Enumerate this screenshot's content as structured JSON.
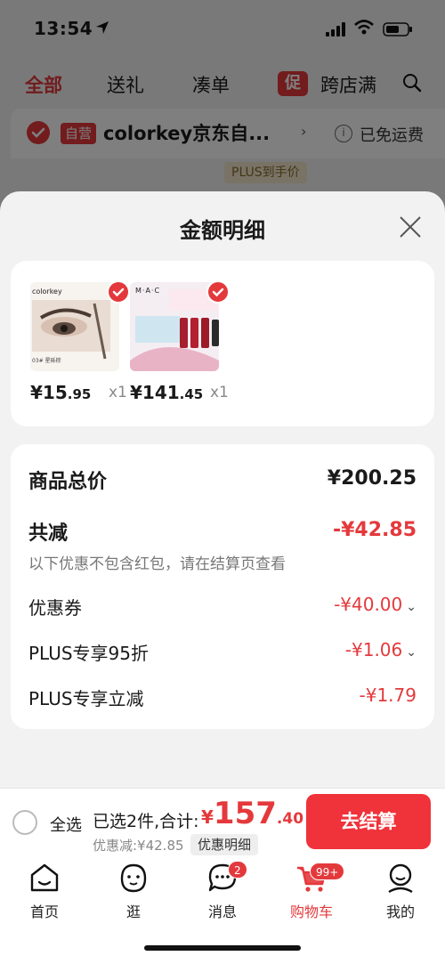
{
  "status_bar": {
    "time": "13:54"
  },
  "category_tabs": {
    "items": [
      "全部",
      "送礼",
      "凑单",
      "跨店满"
    ],
    "promo_badge": "促"
  },
  "store": {
    "tag": "自营",
    "name": "colorkey京东自...",
    "shipping": "已免运费",
    "plus_tag": "PLUS到手价"
  },
  "sheet": {
    "title": "金额明细",
    "products": [
      {
        "brand": "colorkey",
        "price_int": "¥15",
        "price_dec": ".95",
        "qty": "x1"
      },
      {
        "brand": "MAC",
        "price_int": "¥141",
        "price_dec": ".45",
        "qty": "x1"
      }
    ],
    "summary": {
      "total_label": "商品总价",
      "total_value": "¥200.25",
      "reduce_label": "共减",
      "reduce_value": "-¥42.85",
      "reduce_note": "以下优惠不包含红包，请在结算页查看",
      "coupon_label": "优惠券",
      "coupon_value": "-¥40.00",
      "plus95_label": "PLUS专享95折",
      "plus95_value": "-¥1.06",
      "plus_reduce_label": "PLUS专享立减",
      "plus_reduce_value": "-¥1.79"
    }
  },
  "bottom_bar": {
    "select_all": "全选",
    "selected_text": "已选2件,合计:",
    "total_currency": "¥",
    "total_int": "157",
    "total_dec": ".40",
    "discount_text": "优惠减:¥42.85",
    "detail_button": "优惠明细",
    "checkout_button": "去结算"
  },
  "tabbar": {
    "items": [
      {
        "label": "首页"
      },
      {
        "label": "逛"
      },
      {
        "label": "消息",
        "badge": "2"
      },
      {
        "label": "购物车",
        "badge": "99+"
      },
      {
        "label": "我的"
      }
    ]
  },
  "colors": {
    "accent": "#e4393c",
    "checkout": "#f0323a"
  }
}
